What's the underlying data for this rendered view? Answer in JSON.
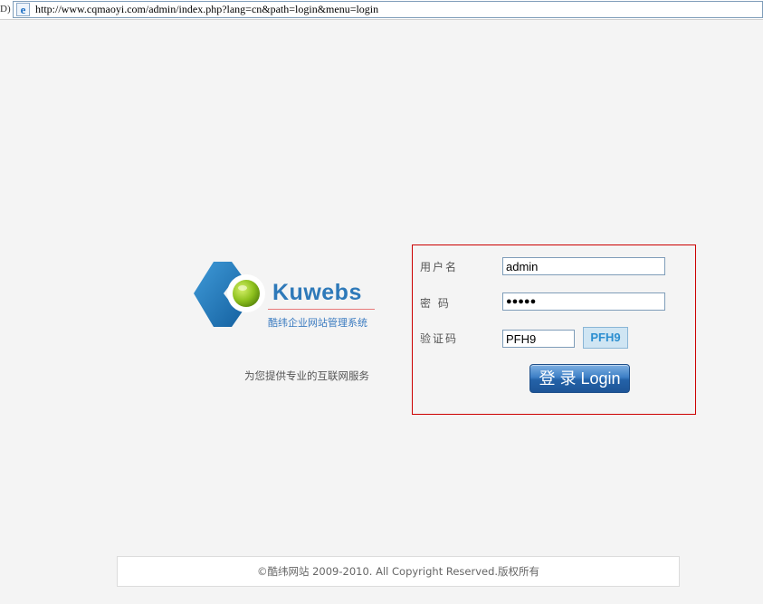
{
  "browser": {
    "left_fragment": "D)",
    "url": "http://www.cqmaoyi.com/admin/index.php?lang=cn&path=login&menu=login"
  },
  "logo": {
    "brand": "Kuwebs",
    "subtitle": "酷纬企业网站管理系统",
    "slogan": "为您提供专业的互联网服务"
  },
  "login": {
    "username_label": "用户名",
    "username_value": "admin",
    "password_label": "密 码",
    "password_value": "●●●●●",
    "captcha_label": "验证码",
    "captcha_value": "PFH9",
    "captcha_image_text": "PFH9",
    "submit_label": "登 录  Login"
  },
  "footer": {
    "text": "©酷纬网站  2009-2010. All Copyright Reserved.版权所有"
  },
  "colors": {
    "brand_blue": "#2e79b9",
    "box_border": "#cc0000",
    "background": "#f4f4f4"
  }
}
